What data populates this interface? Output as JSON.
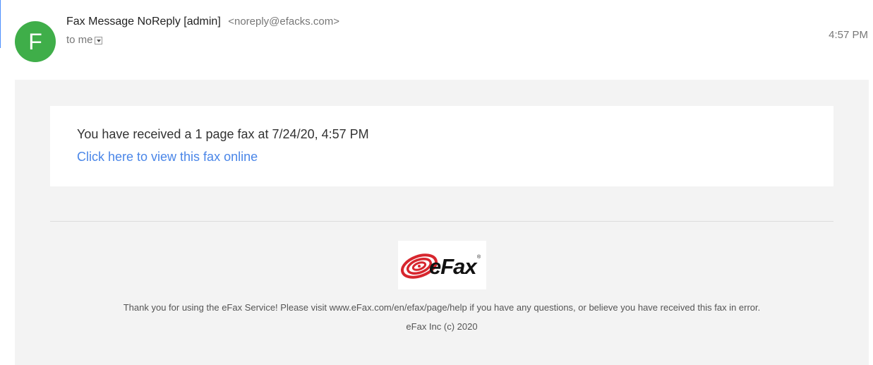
{
  "email": {
    "avatar_letter": "F",
    "sender_name": "Fax Message NoReply [admin]",
    "sender_email": "<noreply@efacks.com>",
    "recipient": "to me",
    "time": "4:57 PM"
  },
  "message": {
    "text": "You have received a 1 page fax at 7/24/20, 4:57 PM",
    "link_text": "Click here to view this fax online"
  },
  "logo": {
    "brand": "eFax",
    "mark": "®"
  },
  "footer": {
    "line1": "Thank you for using the eFax Service! Please visit www.eFax.com/en/efax/page/help if you have any questions, or believe you have received this fax in error.",
    "line2": "eFax Inc (c) 2020"
  },
  "colors": {
    "avatar_bg": "#3fae49",
    "link": "#4a86e8",
    "brand_red": "#d7262e"
  }
}
